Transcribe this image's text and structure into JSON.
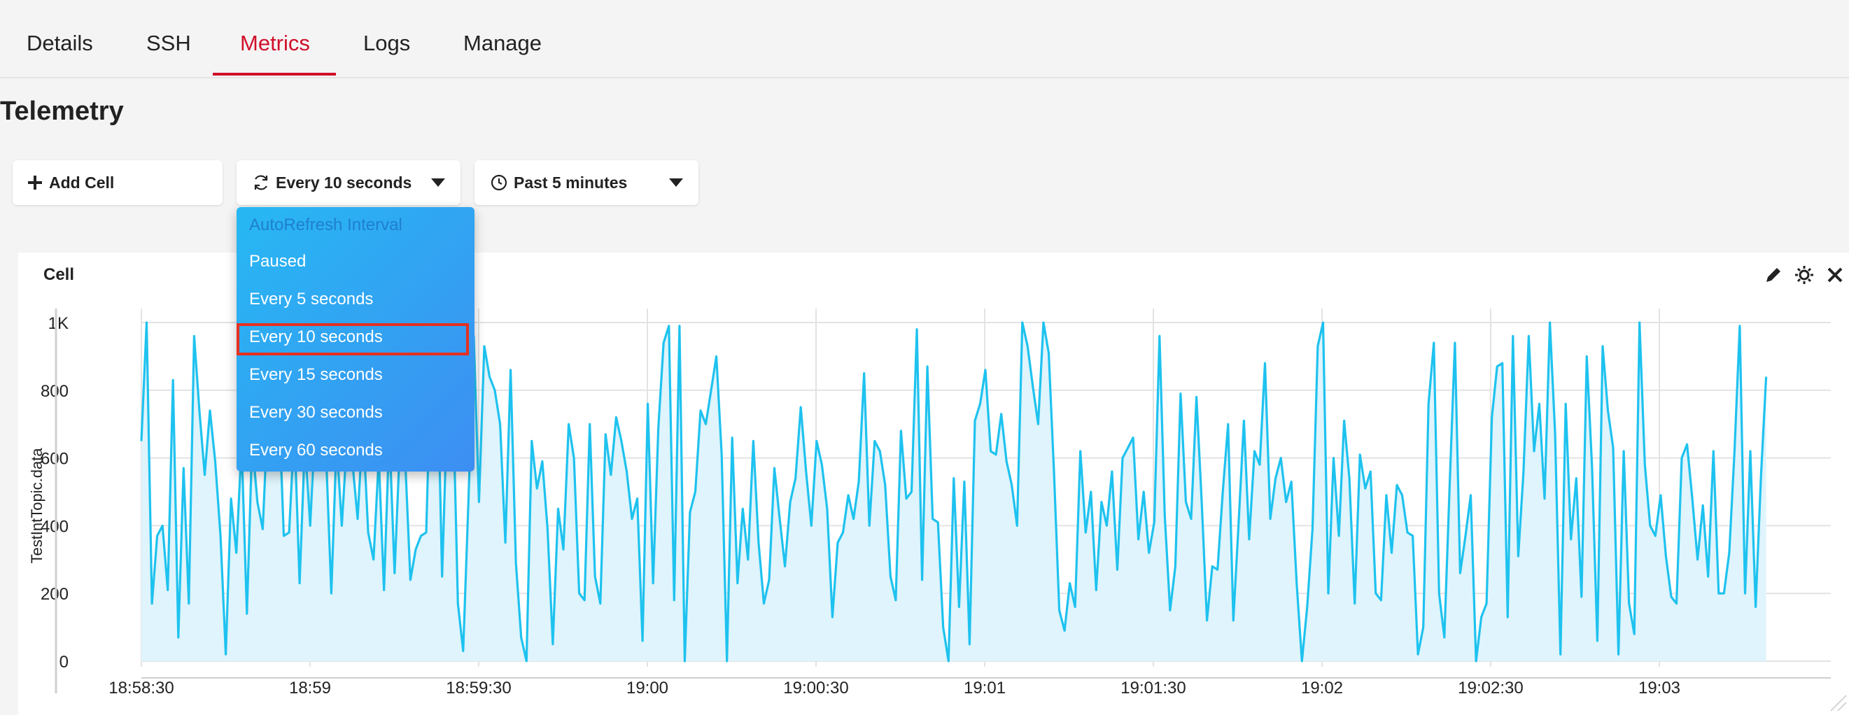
{
  "tabs": [
    {
      "label": "Details"
    },
    {
      "label": "SSH"
    },
    {
      "label": "Metrics"
    },
    {
      "label": "Logs"
    },
    {
      "label": "Manage"
    }
  ],
  "active_tab": "Metrics",
  "page_title": "Telemetry",
  "toolbar": {
    "add_cell_label": "Add Cell",
    "refresh_label": "Every 10 seconds",
    "timerange_label": "Past 5 minutes"
  },
  "dropdown": {
    "header": "AutoRefresh Interval",
    "items": [
      "Paused",
      "Every 5 seconds",
      "Every 10 seconds",
      "Every 15 seconds",
      "Every 30 seconds",
      "Every 60 seconds"
    ],
    "selected": "Every 10 seconds"
  },
  "cell": {
    "title": "Cell"
  },
  "colors": {
    "accent": "#d0102b",
    "series": "#1ec2ef",
    "fill": "#dff4fc",
    "dropdown": "#2aa9f3"
  },
  "chart_data": {
    "type": "area",
    "ylabel": "TestIntTopic.data",
    "ylim": [
      0,
      1000
    ],
    "yticks": [
      {
        "v": 0,
        "label": "0"
      },
      {
        "v": 200,
        "label": "200"
      },
      {
        "v": 400,
        "label": "400"
      },
      {
        "v": 600,
        "label": "600"
      },
      {
        "v": 800,
        "label": "800"
      },
      {
        "v": 1000,
        "label": "1K"
      }
    ],
    "xrange_seconds": [
      0,
      300
    ],
    "xticks": [
      {
        "t": 0,
        "label": "18:58:30"
      },
      {
        "t": 30,
        "label": "18:59"
      },
      {
        "t": 60,
        "label": "18:59:30"
      },
      {
        "t": 90,
        "label": "19:00"
      },
      {
        "t": 120,
        "label": "19:00:30"
      },
      {
        "t": 150,
        "label": "19:01"
      },
      {
        "t": 180,
        "label": "19:01:30"
      },
      {
        "t": 210,
        "label": "19:02"
      },
      {
        "t": 240,
        "label": "19:02:30"
      },
      {
        "t": 270,
        "label": "19:03"
      }
    ],
    "series": [
      {
        "name": "TestIntTopic.data",
        "t_start": 0,
        "t_end": 289,
        "values": [
          650,
          1000,
          170,
          370,
          400,
          210,
          830,
          70,
          570,
          170,
          960,
          740,
          550,
          740,
          590,
          370,
          20,
          480,
          320,
          640,
          140,
          650,
          470,
          390,
          740,
          600,
          790,
          370,
          380,
          690,
          230,
          650,
          400,
          710,
          600,
          620,
          200,
          650,
          400,
          660,
          590,
          420,
          700,
          380,
          300,
          600,
          210,
          680,
          260,
          640,
          600,
          240,
          330,
          370,
          380,
          940,
          960,
          250,
          760,
          830,
          170,
          30,
          470,
          960,
          470,
          930,
          840,
          800,
          700,
          350,
          860,
          290,
          70,
          0,
          650,
          510,
          590,
          390,
          50,
          450,
          330,
          700,
          600,
          200,
          180,
          700,
          250,
          170,
          670,
          550,
          720,
          650,
          560,
          420,
          480,
          60,
          760,
          230,
          690,
          940,
          990,
          180,
          990,
          0,
          440,
          500,
          740,
          700,
          800,
          900,
          610,
          0,
          660,
          230,
          450,
          300,
          650,
          350,
          170,
          240,
          570,
          420,
          280,
          470,
          540,
          750,
          560,
          400,
          650,
          580,
          450,
          130,
          350,
          380,
          490,
          420,
          530,
          850,
          400,
          650,
          620,
          520,
          250,
          180,
          680,
          480,
          500,
          980,
          240,
          870,
          420,
          410,
          100,
          0,
          540,
          160,
          530,
          50,
          710,
          760,
          860,
          620,
          610,
          730,
          590,
          520,
          400,
          1000,
          930,
          810,
          700,
          1000,
          910,
          560,
          150,
          90,
          230,
          160,
          620,
          380,
          500,
          210,
          470,
          400,
          560,
          270,
          600,
          630,
          660,
          360,
          500,
          320,
          410,
          960,
          430,
          150,
          280,
          790,
          470,
          420,
          780,
          470,
          120,
          280,
          270,
          500,
          700,
          120,
          410,
          710,
          360,
          620,
          580,
          880,
          420,
          540,
          600,
          470,
          530,
          230,
          0,
          160,
          390,
          930,
          1000,
          200,
          600,
          370,
          710,
          540,
          170,
          610,
          510,
          560,
          200,
          180,
          490,
          320,
          520,
          490,
          380,
          370,
          20,
          100,
          760,
          940,
          200,
          70,
          520,
          940,
          260,
          370,
          490,
          0,
          130,
          170,
          720,
          870,
          880,
          130,
          960,
          310,
          560,
          960,
          620,
          760,
          480,
          1000,
          670,
          20,
          760,
          360,
          540,
          190,
          900,
          570,
          60,
          930,
          740,
          630,
          20,
          620,
          170,
          80,
          1000,
          580,
          400,
          370,
          490,
          310,
          190,
          170,
          600,
          640,
          480,
          300,
          460,
          250,
          620,
          200,
          200,
          320,
          620,
          990,
          200,
          620,
          160,
          540,
          840
        ]
      }
    ]
  }
}
